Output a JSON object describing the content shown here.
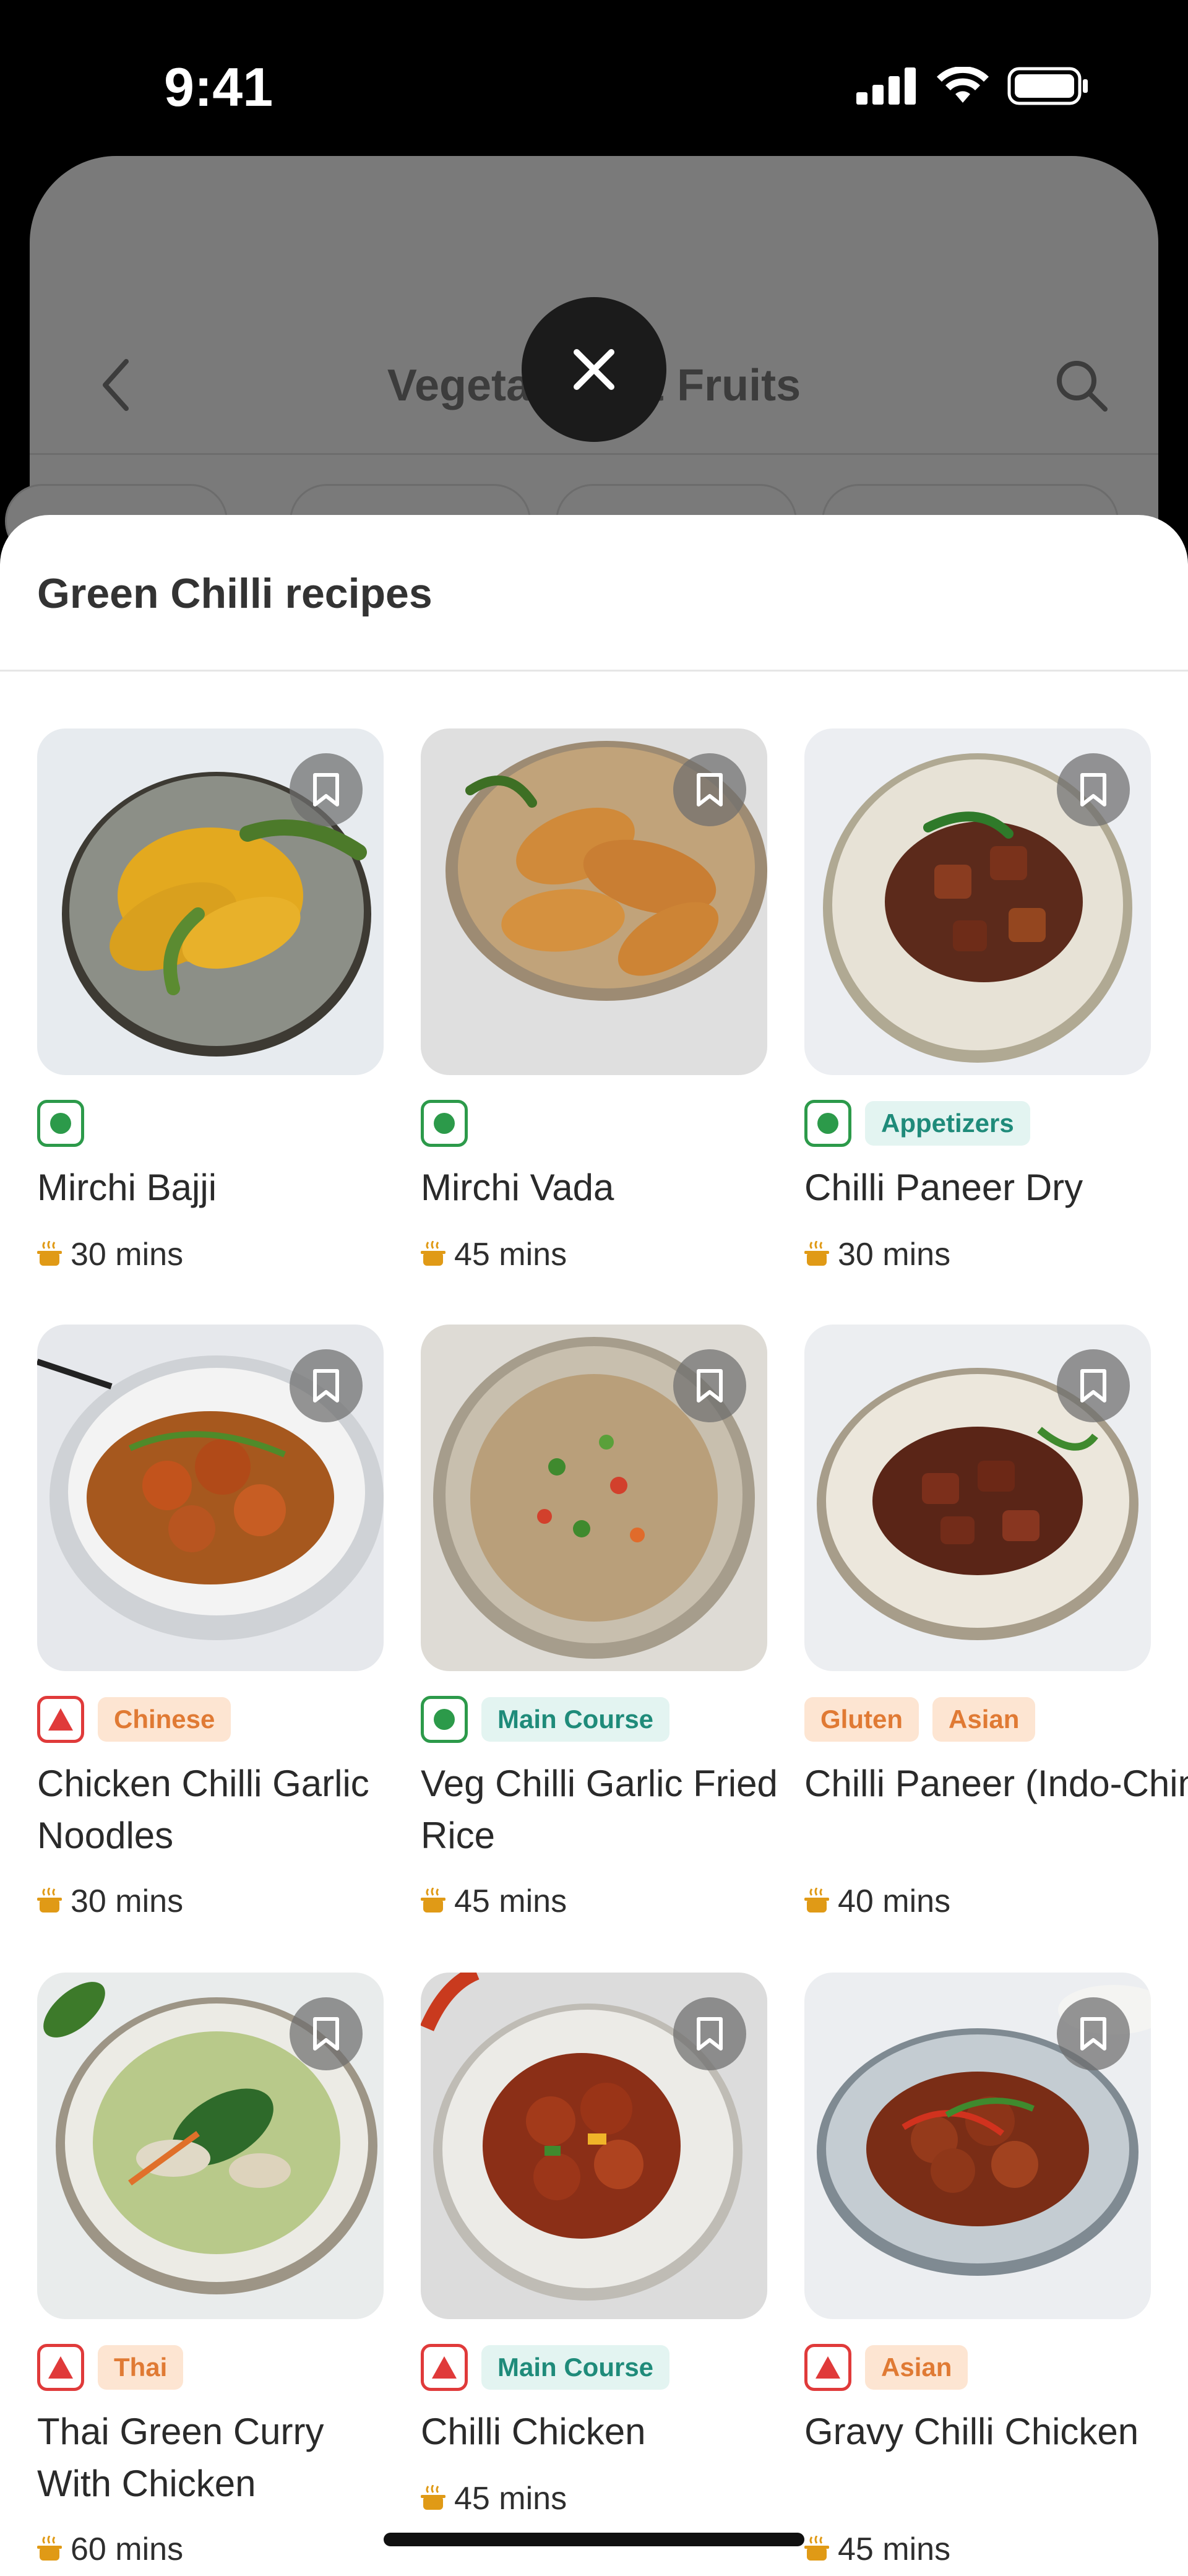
{
  "status_bar": {
    "time": "9:41"
  },
  "background_page": {
    "title": "Vegetables & Fruits"
  },
  "sheet": {
    "title": "Green Chilli recipes"
  },
  "colors": {
    "veg": "#2c9a4a",
    "nonveg": "#e03a3a",
    "tag_teal": "#1f8b7a",
    "tag_orange": "#e07a34"
  },
  "recipes": [
    {
      "name": "Mirchi Bajji",
      "time": "30 mins",
      "diet": "veg",
      "tags": []
    },
    {
      "name": "Mirchi Vada",
      "time": "45 mins",
      "diet": "veg",
      "tags": []
    },
    {
      "name": "Chilli Paneer Dry",
      "time": "30 mins",
      "diet": "veg",
      "tags": [
        "Appetizers"
      ]
    },
    {
      "name": "Chicken Chilli Garlic Noodles",
      "time": "30 mins",
      "diet": "nonveg",
      "tags": [
        "Chinese"
      ]
    },
    {
      "name": "Veg Chilli Garlic Fried Rice",
      "time": "45 mins",
      "diet": "veg",
      "tags": [
        "Main Course"
      ]
    },
    {
      "name": "Chilli Paneer (Indo-Chinese St...",
      "time": "40 mins",
      "diet": "none",
      "tags": [
        "Gluten",
        "Asian"
      ]
    },
    {
      "name": "Thai Green Curry With Chicken",
      "time": "60 mins",
      "diet": "nonveg",
      "tags": [
        "Thai"
      ]
    },
    {
      "name": "Chilli Chicken",
      "time": "45 mins",
      "diet": "nonveg",
      "tags": [
        "Main Course"
      ]
    },
    {
      "name": "Gravy Chilli Chicken",
      "time": "45 mins",
      "diet": "nonveg",
      "tags": [
        "Asian"
      ]
    }
  ]
}
